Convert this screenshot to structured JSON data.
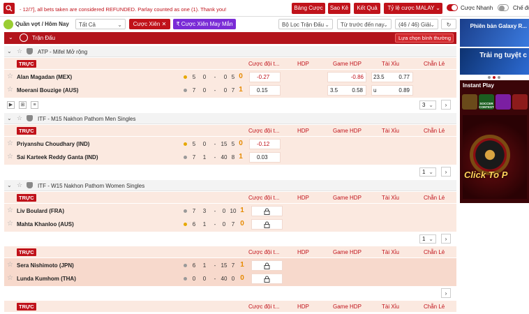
{
  "ticker": "- 12/7], all bets taken are considered REFUNDED. Parlay counted as one (1). Thank you!",
  "top_buttons": {
    "statement": "Bảng Cược",
    "history": "Sao Kê",
    "results": "Kết Quả",
    "odds_type": "Tỷ lệ cược MALAY"
  },
  "toggles": {
    "quick_bet": "Cược Nhanh",
    "mode2": "Chế độ"
  },
  "filter": {
    "sport": "Quần vợt / Hôm Nay",
    "all": "Tất Cả",
    "parlay": "Cược Xiên",
    "lucky_parlay": "Cược Xiên May Mắn",
    "league_filter": "Bộ Lọc Trận Đấu",
    "sort": "Từ trước đến nay",
    "count": "(46 / 46) Giải"
  },
  "list_header": {
    "title": "Trận Đấu",
    "view": "Lựa chọn bình thường"
  },
  "live_label": "TRỰC",
  "columns": {
    "handicap_ft": "Cược đội t...",
    "hdp": "HDP",
    "game_hdp": "Game HDP",
    "over_under": "Tài Xỉu",
    "odd_even": "Chẵn Lẻ"
  },
  "leagues": [
    {
      "name": "ATP - Mifel Mở rộng",
      "players": [
        {
          "name": "Alan Magadan (MEX)",
          "scores": [
            "5",
            "0",
            "-",
            "0",
            "5"
          ],
          "games": "0",
          "odds": "-0.27",
          "game_hdp_line": "",
          "game_hdp": "-0.86",
          "ou_line": "23.5",
          "ou": "0.77"
        },
        {
          "name": "Moerani Bouzige (AUS)",
          "scores": [
            "7",
            "0",
            "-",
            "0",
            "7"
          ],
          "games": "1",
          "odds": "0.15",
          "game_hdp_line": "3.5",
          "game_hdp": "0.58",
          "ou_line": "u",
          "ou": "0.89"
        }
      ],
      "page": "3"
    },
    {
      "name": "ITF - M15 Nakhon Pathom Men Singles",
      "players": [
        {
          "name": "Priyanshu Choudhary (IND)",
          "scores": [
            "5",
            "0",
            "-",
            "15",
            "5"
          ],
          "games": "0",
          "odds": "-0.12"
        },
        {
          "name": "Sai Karteek Reddy Ganta (IND)",
          "scores": [
            "7",
            "1",
            "-",
            "40",
            "8"
          ],
          "games": "1",
          "odds": "0.03"
        }
      ],
      "page": "1"
    },
    {
      "name": "ITF - W15 Nakhon Pathom Women Singles",
      "players": [
        {
          "name": "Liv Boulard (FRA)",
          "scores": [
            "7",
            "3",
            "-",
            "0",
            "10"
          ],
          "games": "1"
        },
        {
          "name": "Mahta Khanloo (AUS)",
          "scores": [
            "6",
            "1",
            "-",
            "0",
            "7"
          ],
          "games": "0"
        }
      ],
      "page": "1"
    },
    {
      "name": "",
      "players": [
        {
          "name": "Sera Nishimoto (JPN)",
          "scores": [
            "6",
            "1",
            "-",
            "15",
            "7"
          ],
          "games": "1"
        },
        {
          "name": "Lunda Kumhom (THA)",
          "scores": [
            "0",
            "0",
            "-",
            "40",
            "0"
          ],
          "games": "0"
        }
      ]
    }
  ],
  "ads": {
    "banner1": "Phiên bản Galaxy R...",
    "banner2": "Trải ng tuyệt c",
    "instant_title": "Instant Play",
    "game1": "",
    "game2": "SOCCER CONTEST",
    "game3": "",
    "game4": "",
    "cta": "Click To P"
  },
  "colors": {
    "brand_red": "#c0121a",
    "purple": "#7a2bd6",
    "row_bg": "#fbe9e0",
    "live_dot_orange": "#e6a800",
    "live_dot_gray": "#999999"
  }
}
